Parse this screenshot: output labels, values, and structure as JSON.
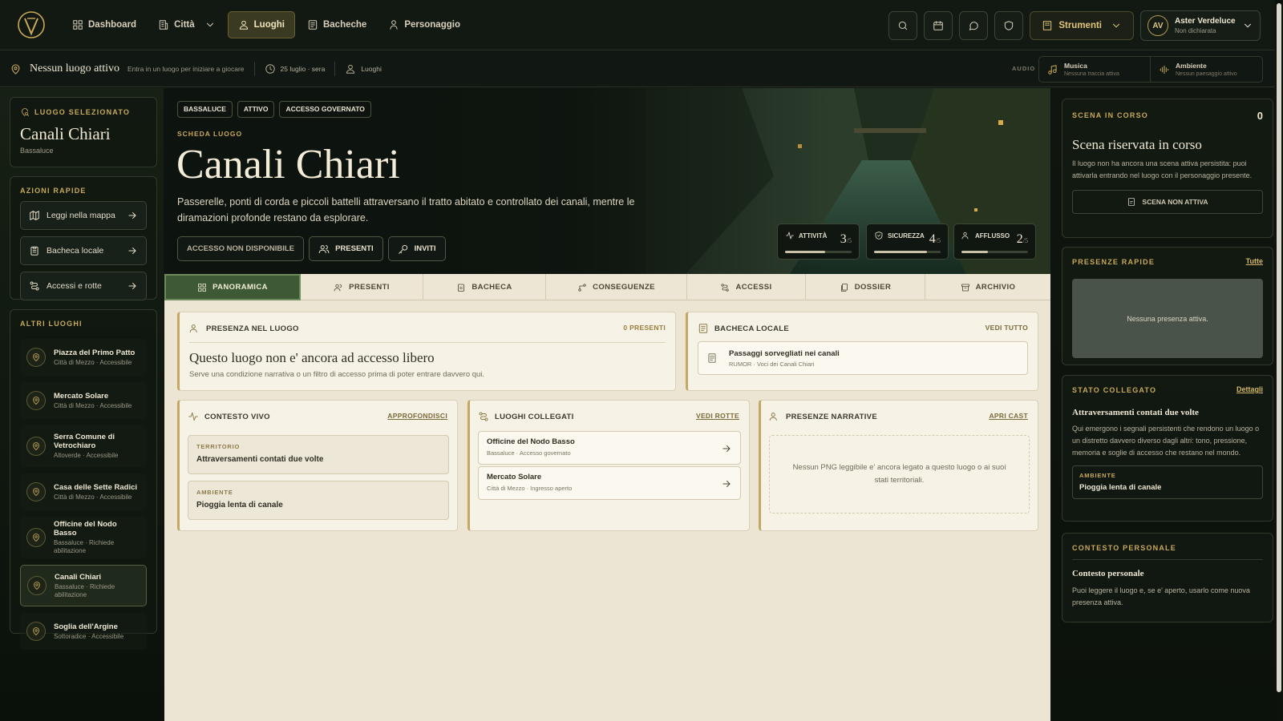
{
  "topbar": {
    "nav": [
      {
        "label": "Dashboard",
        "icon": "grid-icon"
      },
      {
        "label": "Città",
        "icon": "building-icon"
      },
      {
        "label": "Luoghi",
        "icon": "user-pin-icon"
      },
      {
        "label": "Bacheche",
        "icon": "board-icon"
      },
      {
        "label": "Personaggio",
        "icon": "person-icon"
      }
    ],
    "tools_label": "Strumenti",
    "user": {
      "initials": "AV",
      "name": "Aster Verdeluce",
      "status": "Non dichiarata"
    }
  },
  "subbar": {
    "location": "Nessun luogo attivo",
    "hint": "Entra in un luogo per iniziare a giocare",
    "date": "25 luglio · sera",
    "section": "Luoghi",
    "audio_label": "AUDIO",
    "music": {
      "title": "Musica",
      "sub": "Nessuna traccia attiva"
    },
    "ambient": {
      "title": "Ambiente",
      "sub": "Nessun paesaggio attivo"
    }
  },
  "left": {
    "selected_label": "LUOGO SELEZIONATO",
    "selected_name": "Canali Chiari",
    "selected_sub": "Bassaluce",
    "quick_label": "AZIONI RAPIDE",
    "quick": [
      "Leggi nella mappa",
      "Bacheca locale",
      "Accessi e rotte"
    ],
    "other_label": "ALTRI LUOGHI",
    "places": [
      {
        "name": "Piazza del Primo Patto",
        "sub": "Città di Mezzo · Accessibile"
      },
      {
        "name": "Mercato Solare",
        "sub": "Città di Mezzo · Accessibile"
      },
      {
        "name": "Serra Comune di Vetrochiaro",
        "sub": "Altoverde · Accessibile"
      },
      {
        "name": "Casa delle Sette Radici",
        "sub": "Città di Mezzo · Accessibile"
      },
      {
        "name": "Officine del Nodo Basso",
        "sub": "Bassaluce · Richiede abilitazione"
      },
      {
        "name": "Canali Chiari",
        "sub": "Bassaluce · Richiede abilitazione"
      },
      {
        "name": "Soglia dell'Argine",
        "sub": "Sottoradice · Accessibile"
      }
    ]
  },
  "hero": {
    "tags": [
      "BASSALUCE",
      "ATTIVO",
      "ACCESSO GOVERNATO"
    ],
    "kicker": "SCHEDA LUOGO",
    "title": "Canali Chiari",
    "description": "Passerelle, ponti di corda e piccoli battelli attraversano il tratto abitato e controllato dei canali, mentre le diramazioni profonde restano da esplorare.",
    "buttons": [
      "ACCESSO NON DISPONIBILE",
      "PRESENTI",
      "INVITI"
    ],
    "stats": [
      {
        "label": "ATTIVITÀ",
        "value": "3",
        "max": "/5",
        "level": 0.6
      },
      {
        "label": "SICUREZZA",
        "value": "4",
        "max": "/5",
        "level": 0.8
      },
      {
        "label": "AFFLUSSO",
        "value": "2",
        "max": "/5",
        "level": 0.4
      }
    ]
  },
  "tabs": [
    "PANORAMICA",
    "PRESENTI",
    "BACHECA",
    "CONSEGUENZE",
    "ACCESSI",
    "DOSSIER",
    "ARCHIVIO"
  ],
  "presence": {
    "title": "PRESENZA NEL LUOGO",
    "count": "0 PRESENTI",
    "heading": "Questo luogo non e' ancora ad accesso libero",
    "text": "Serve una condizione narrativa o un filtro di accesso prima di poter entrare davvero qui."
  },
  "board": {
    "title": "BACHECA LOCALE",
    "link": "VEDI TUTTO",
    "item_title": "Passaggi sorvegliati nei canali",
    "item_sub": "RUMOR · Voci dei Canali Chiari"
  },
  "context": {
    "title": "CONTESTO VIVO",
    "link": "APPROFONDISCI",
    "items": [
      {
        "label": "TERRITORIO",
        "value": "Attraversamenti contati due volte"
      },
      {
        "label": "AMBIENTE",
        "value": "Pioggia lenta di canale"
      }
    ]
  },
  "linked": {
    "title": "LUOGHI COLLEGATI",
    "link": "VEDI ROTTE",
    "items": [
      {
        "name": "Officine del Nodo Basso",
        "sub": "Bassaluce · Accesso governato"
      },
      {
        "name": "Mercato Solare",
        "sub": "Città di Mezzo · Ingresso aperto"
      }
    ]
  },
  "narrative": {
    "title": "PRESENZE NARRATIVE",
    "link": "APRI CAST",
    "empty": "Nessun PNG leggibile e' ancora legato a questo luogo o ai suoi stati territoriali."
  },
  "right": {
    "scene_label": "SCENA IN CORSO",
    "scene_count": "0",
    "scene_title": "Scena riservata in corso",
    "scene_text": "Il luogo non ha ancora una scena attiva persistita: puoi attivarla entrando nel luogo con il personaggio presente.",
    "scene_button": "SCENA NON ATTIVA",
    "quick_label": "PRESENZE RAPIDE",
    "quick_link": "Tutte",
    "quick_empty": "Nessuna presenza attiva.",
    "state_label": "STATO COLLEGATO",
    "state_link": "Dettagli",
    "state_title": "Attraversamenti contati due volte",
    "state_text": "Qui emergono i segnali persistenti che rendono un luogo o un distretto davvero diverso dagli altri: tono, pressione, memoria e soglie di accesso che restano nel mondo.",
    "state_env_label": "AMBIENTE",
    "state_env_value": "Pioggia lenta di canale",
    "personal_label": "CONTESTO PERSONALE",
    "personal_title": "Contesto personale",
    "personal_text": "Puoi leggere il luogo e, se e' aperto, usarlo come nuova presenza attiva."
  },
  "colors": {
    "accent": "#c9a95a",
    "active_tab": "#3e5a34",
    "panel": "#f7f2e6"
  }
}
